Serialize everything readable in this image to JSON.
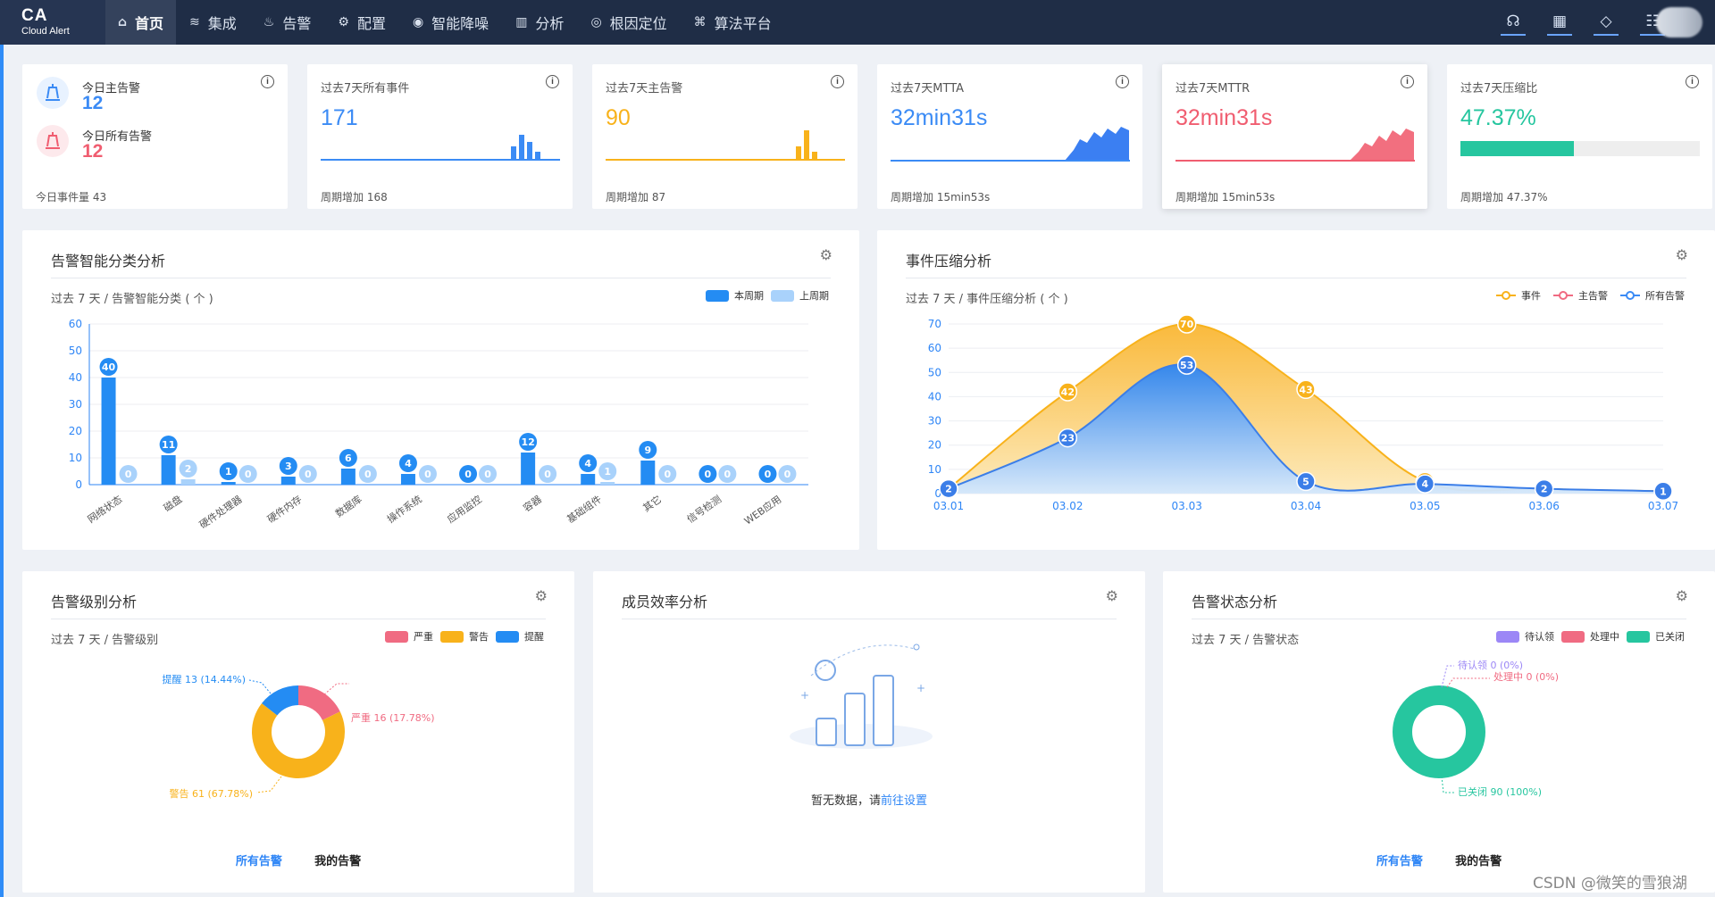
{
  "app": {
    "logo_main": "CA",
    "logo_sub": "Cloud Alert"
  },
  "nav": [
    {
      "label": "首页",
      "icon": "home-icon",
      "glyph": "⌂",
      "active": true
    },
    {
      "label": "集成",
      "icon": "layers-icon",
      "glyph": "≋"
    },
    {
      "label": "告警",
      "icon": "alarm-icon",
      "glyph": "♨"
    },
    {
      "label": "配置",
      "icon": "gear-icon",
      "glyph": "⚙"
    },
    {
      "label": "智能降噪",
      "icon": "noise-icon",
      "glyph": "◉"
    },
    {
      "label": "分析",
      "icon": "bar-chart-icon",
      "glyph": "▥"
    },
    {
      "label": "根因定位",
      "icon": "target-icon",
      "glyph": "◎"
    },
    {
      "label": "算法平台",
      "icon": "algorithm-icon",
      "glyph": "⌘"
    }
  ],
  "tools": [
    {
      "icon": "headset-icon",
      "glyph": "☊"
    },
    {
      "icon": "calendar-icon",
      "glyph": "▦"
    },
    {
      "icon": "notification-icon",
      "glyph": "◇"
    },
    {
      "icon": "sliders-icon",
      "glyph": "☷"
    }
  ],
  "kpis": {
    "today": {
      "main_label": "今日主告警",
      "main_value": "12",
      "all_label": "今日所有告警",
      "all_value": "12",
      "foot": "今日事件量 43",
      "info": "i"
    },
    "events": {
      "title": "过去7天所有事件",
      "value": "171",
      "foot": "周期增加 168",
      "color": "#3b8bf5",
      "bars": [
        0.45,
        0.85,
        0.6,
        0.25
      ]
    },
    "main": {
      "title": "过去7天主告警",
      "value": "90",
      "foot": "周期增加 87",
      "color": "#f8b21b",
      "bars": [
        0.45,
        1.0,
        0.25
      ]
    },
    "mtta": {
      "title": "过去7天MTTA",
      "value": "32min31s",
      "foot": "周期增加 15min53s",
      "color": "#3b8bf5"
    },
    "mttr": {
      "title": "过去7天MTTR",
      "value": "32min31s",
      "foot": "周期增加 15min53s",
      "color": "#f05d70"
    },
    "compress": {
      "title": "过去7天压缩比",
      "value": "47.37%",
      "foot": "周期增加 47.37%",
      "color": "#26c69f",
      "progress": 0.4737
    }
  },
  "panel_class": {
    "title": "告警智能分类分析",
    "subtitle": "过去 7 天 / 告警智能分类 ( 个 )",
    "legend": [
      "本周期",
      "上周期"
    ],
    "colors": {
      "current": "#248cf3",
      "previous": "#a9d2fb"
    },
    "chart_data": {
      "type": "bar",
      "categories": [
        "网络状态",
        "磁盘",
        "硬件处理器",
        "硬件内存",
        "数据库",
        "操作系统",
        "应用监控",
        "容器",
        "基础组件",
        "其它",
        "信号检测",
        "WEB应用"
      ],
      "series": [
        {
          "name": "本周期",
          "values": [
            40,
            11,
            1,
            3,
            6,
            4,
            0,
            12,
            4,
            9,
            0,
            0
          ]
        },
        {
          "name": "上周期",
          "values": [
            0,
            2,
            0,
            0,
            0,
            0,
            0,
            0,
            1,
            0,
            0,
            0
          ]
        }
      ],
      "ylim": [
        0,
        60
      ],
      "yticks": [
        0,
        10,
        20,
        30,
        40,
        50,
        60
      ]
    }
  },
  "panel_compress": {
    "title": "事件压缩分析",
    "subtitle": "过去 7 天 / 事件压缩分析 ( 个 )",
    "legend": [
      "事件",
      "主告警",
      "所有告警"
    ],
    "legend_colors": [
      "#f8b21b",
      "#f06b82",
      "#3b8bf5"
    ],
    "chart_data": {
      "type": "area",
      "x": [
        "03.01",
        "03.02",
        "03.03",
        "03.04",
        "03.05",
        "03.06",
        "03.07"
      ],
      "series": [
        {
          "name": "事件",
          "values": [
            2,
            42,
            70,
            43,
            5,
            2,
            1
          ]
        },
        {
          "name": "所有告警",
          "values": [
            2,
            23,
            53,
            5,
            4,
            2,
            1
          ]
        }
      ],
      "ylim": [
        0,
        70
      ],
      "yticks": [
        0,
        10,
        20,
        30,
        40,
        50,
        60,
        70
      ]
    }
  },
  "panel_level": {
    "title": "告警级别分析",
    "subtitle": "过去 7 天 / 告警级别",
    "legend": [
      "严重",
      "警告",
      "提醒"
    ],
    "colors": [
      "#f06b82",
      "#f8b21b",
      "#248cf3"
    ],
    "chart_data": {
      "type": "pie",
      "labels": [
        "严重",
        "警告",
        "提醒"
      ],
      "values": [
        16,
        61,
        13
      ],
      "annotations": [
        "严重 16 (17.78%)",
        "警告 61 (67.78%)",
        "提醒 13 (14.44%)"
      ]
    },
    "tabs": [
      "所有告警",
      "我的告警"
    ]
  },
  "panel_efficiency": {
    "title": "成员效率分析",
    "empty_text": "暂无数据，请",
    "empty_link": "前往设置"
  },
  "panel_status": {
    "title": "告警状态分析",
    "subtitle": "过去 7 天 / 告警状态",
    "legend": [
      "待认领",
      "处理中",
      "已关闭"
    ],
    "colors": [
      "#9c87f6",
      "#f06b82",
      "#26c69f"
    ],
    "chart_data": {
      "type": "pie",
      "labels": [
        "待认领",
        "处理中",
        "已关闭"
      ],
      "values": [
        0,
        0,
        90
      ],
      "annotations": [
        "待认领 0 (0%)",
        "处理中 0 (0%)",
        "已关闭 90 (100%)"
      ]
    },
    "tabs": [
      "所有告警",
      "我的告警"
    ]
  },
  "watermark": "CSDN @微笑的雪狼湖"
}
